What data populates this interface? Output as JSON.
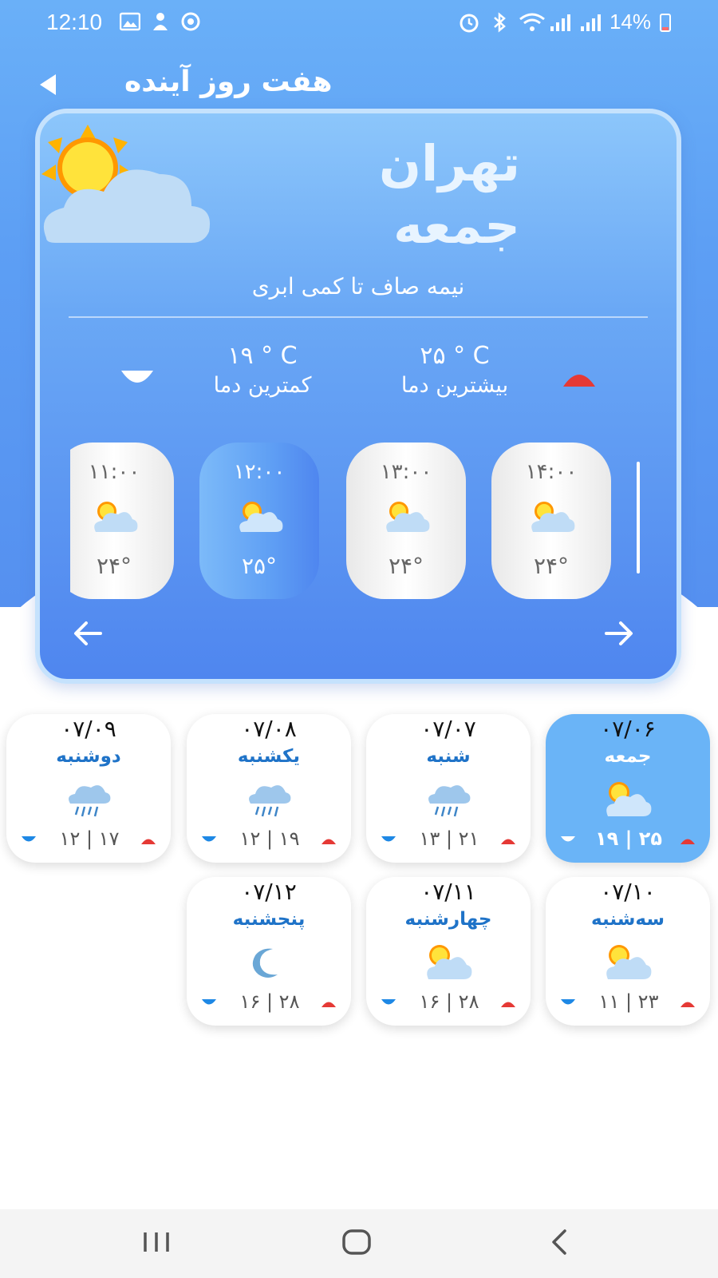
{
  "status_bar": {
    "time": "12:10",
    "battery": "14%"
  },
  "header": {
    "title": "هفت روز آینده"
  },
  "today": {
    "city": "تهران",
    "day": "جمعه",
    "condition": "نیمه صاف تا کمی ابری",
    "max_value": "۲۵ ° C",
    "max_label": "بیشترین دما",
    "min_value": "۱۹ ° C",
    "min_label": "کمترین دما",
    "hours": [
      {
        "time": "۱۴:۰۰",
        "temp": "۲۴°"
      },
      {
        "time": "۱۳:۰۰",
        "temp": "۲۴°"
      },
      {
        "time": "۱۲:۰۰",
        "temp": "۲۵°"
      },
      {
        "time": "۱۱:۰۰",
        "temp": "۲۴°"
      }
    ]
  },
  "days": [
    {
      "date": "۰۷/۰۶",
      "day": "جمعه",
      "range": "۱۹ | ۲۵",
      "icon": "partly-cloudy-icon"
    },
    {
      "date": "۰۷/۰۷",
      "day": "شنبه",
      "range": "۱۳ | ۲۱",
      "icon": "rain-icon"
    },
    {
      "date": "۰۷/۰۸",
      "day": "یکشنبه",
      "range": "۱۲ | ۱۹",
      "icon": "rain-icon"
    },
    {
      "date": "۰۷/۰۹",
      "day": "دوشنبه",
      "range": "۱۲ | ۱۷",
      "icon": "rain-icon"
    },
    {
      "date": "۰۷/۱۰",
      "day": "سه‌شنبه",
      "range": "۱۱ | ۲۳",
      "icon": "partly-cloudy-icon"
    },
    {
      "date": "۰۷/۱۱",
      "day": "چهارشنبه",
      "range": "۱۶ | ۲۸",
      "icon": "partly-cloudy-icon"
    },
    {
      "date": "۰۷/۱۲",
      "day": "پنجشنبه",
      "range": "۱۶ | ۲۸",
      "icon": "moon-icon"
    }
  ],
  "colors": {
    "accent": "#5d9ff4",
    "active_day": "#6ab4f7",
    "up_arrow": "#e53935",
    "down_arrow": "#1e88e5",
    "day_text": "#1f73c8"
  }
}
